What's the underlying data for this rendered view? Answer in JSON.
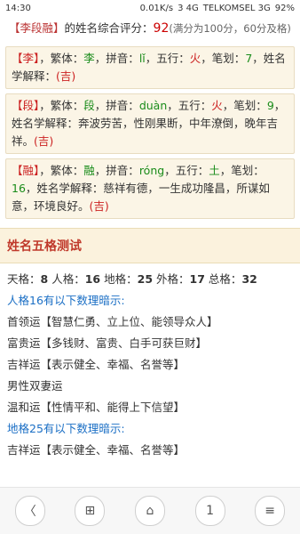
{
  "status": {
    "time": "14:30",
    "speed": "0.01K/s",
    "network1": "3 4G",
    "carrier": "TELKOMSEL 3G",
    "battery": "92%"
  },
  "summary": {
    "name": "【李段融】",
    "text1": "的姓名综合评分：",
    "score": "92",
    "note": "(满分为100分，60分及格)"
  },
  "chars": [
    {
      "char": "【李】",
      "trad_label": "，繁体：",
      "trad": "李",
      "pinyin_label": "，拼音：",
      "pinyin": "lǐ",
      "wuxing_label": "，五行：",
      "wuxing": "火",
      "strokes_label": "，笔划：",
      "strokes": "7",
      "explain": "，姓名学解释：",
      "luck": "(吉)"
    },
    {
      "char": "【段】",
      "trad_label": "，繁体：",
      "trad": "段",
      "pinyin_label": "，拼音：",
      "pinyin": "duàn",
      "wuxing_label": "，五行：",
      "wuxing": "火",
      "strokes_label": "，笔划：",
      "strokes": "9",
      "explain": "，姓名学解释：奔波劳苦，性刚果断，中年潦倒，晚年吉祥。",
      "luck": "(吉)"
    },
    {
      "char": "【融】",
      "trad_label": "，繁体：",
      "trad": "融",
      "pinyin_label": "，拼音：",
      "pinyin": "róng",
      "wuxing_label": "，五行：",
      "wuxing": "土",
      "strokes_label": "，笔划：",
      "strokes": "16",
      "explain": "，姓名学解释：慈祥有德，一生成功隆昌，所谋如意，环境良好。",
      "luck": "(吉)"
    }
  ],
  "section_title": "姓名五格测试",
  "five_grid": {
    "tian_label": "天格：",
    "tian": "8",
    "ren_label": "人格：",
    "ren": "16",
    "di_label": "地格：",
    "di": "25",
    "wai_label": "外格：",
    "wai": "17",
    "zong_label": "总格：",
    "zong": "32"
  },
  "ren_head": "人格16有以下数理暗示:",
  "ren_items": [
    "首领运【智慧仁勇、立上位、能领导众人】",
    "富贵运【多钱财、富贵、白手可获巨财】",
    "吉祥运【表示健全、幸福、名誉等】",
    "男性双妻运",
    "温和运【性情平和、能得上下信望】"
  ],
  "di_head": "地格25有以下数理暗示:",
  "di_items": [
    "吉祥运【表示健全、幸福、名誉等】"
  ],
  "bottom_nav": {
    "back": "〈",
    "bookmarks": "⊞",
    "home": "⌂",
    "tabs": "1",
    "menu": "≡"
  }
}
